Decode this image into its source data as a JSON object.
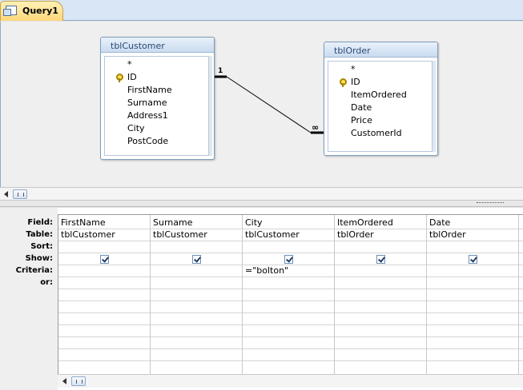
{
  "tab": {
    "title": "Query1",
    "icon": "query-icon"
  },
  "tables": [
    {
      "title": "tblCustomer",
      "fields": [
        "*",
        "ID",
        "FirstName",
        "Surname",
        "Address1",
        "City",
        "PostCode"
      ],
      "primary_key": "ID"
    },
    {
      "title": "tblOrder",
      "fields": [
        "*",
        "ID",
        "ItemOrdered",
        "Date",
        "Price",
        "CustomerId"
      ],
      "primary_key": "ID"
    }
  ],
  "relationship": {
    "one_side": "1",
    "many_side": "∞"
  },
  "grid": {
    "row_labels": [
      "Field:",
      "Table:",
      "Sort:",
      "Show:",
      "Criteria:",
      "or:"
    ],
    "columns": [
      {
        "field": "FirstName",
        "table": "tblCustomer",
        "sort": "",
        "show": true,
        "criteria": ""
      },
      {
        "field": "Surname",
        "table": "tblCustomer",
        "sort": "",
        "show": true,
        "criteria": ""
      },
      {
        "field": "City",
        "table": "tblCustomer",
        "sort": "",
        "show": true,
        "criteria": "=\"bolton\""
      },
      {
        "field": "ItemOrdered",
        "table": "tblOrder",
        "sort": "",
        "show": true,
        "criteria": ""
      },
      {
        "field": "Date",
        "table": "tblOrder",
        "sort": "",
        "show": true,
        "criteria": ""
      }
    ]
  },
  "colors": {
    "tab_active": "#ffd77a",
    "accent": "#2b4a74"
  }
}
